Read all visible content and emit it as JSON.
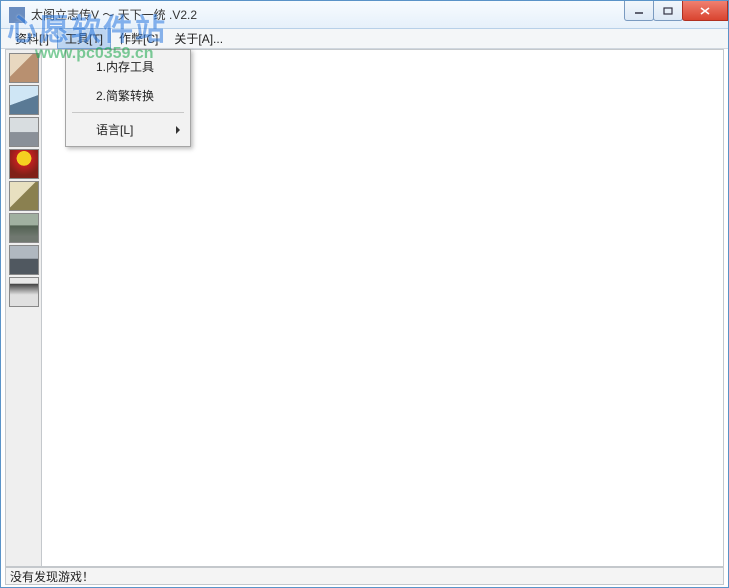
{
  "window": {
    "title": "太阁立志传V ～ 天下一统 .V2.2"
  },
  "menubar": {
    "items": [
      {
        "label": "资料[I]"
      },
      {
        "label": "工具[T]"
      },
      {
        "label": "作弊[C]"
      },
      {
        "label": "关于[A]..."
      }
    ]
  },
  "dropdown": {
    "items": [
      {
        "label": "1.内存工具"
      },
      {
        "label": "2.简繁转换"
      },
      {
        "label": "语言[L]",
        "submenu": true
      }
    ]
  },
  "sidebar": {
    "items": [
      {
        "name": "portrait-1"
      },
      {
        "name": "portrait-2"
      },
      {
        "name": "portrait-3"
      },
      {
        "name": "portrait-4"
      },
      {
        "name": "portrait-5"
      },
      {
        "name": "portrait-6"
      },
      {
        "name": "portrait-7"
      },
      {
        "name": "portrait-8"
      }
    ]
  },
  "statusbar": {
    "text": "没有发现游戏！"
  },
  "watermark": {
    "line1": "心愿软件站",
    "line2": "www.pc0359.cn"
  }
}
